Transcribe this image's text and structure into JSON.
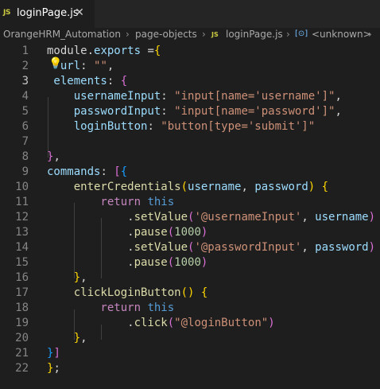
{
  "tab": {
    "lang_badge": "JS",
    "title": "loginPage.js",
    "close_glyph": "✕"
  },
  "breadcrumb": {
    "items": [
      "OrangeHRM_Automation",
      "page-objects",
      "loginPage.js",
      "<unknown>"
    ],
    "js_badge": "JS",
    "symbol_icon": "[⊙]"
  },
  "editor": {
    "active_line": 3,
    "line_numbers": [
      "1",
      "2",
      "3",
      "4",
      "5",
      "6",
      "7",
      "8",
      "9",
      "10",
      "11",
      "12",
      "13",
      "14",
      "15",
      "16",
      "17",
      "18",
      "19",
      "20",
      "21",
      "22"
    ],
    "lines": [
      [
        [
          "module",
          "k-pl"
        ],
        [
          ".",
          "k-pl"
        ],
        [
          "exports",
          "k-var"
        ],
        [
          " =",
          "k-pl"
        ],
        [
          "{",
          "k-b1"
        ]
      ],
      [
        [
          "  ",
          "k-pl"
        ],
        [
          "url",
          "k-var"
        ],
        [
          ": ",
          "k-pl"
        ],
        [
          "\"\"",
          "k-str"
        ],
        [
          ",",
          "k-pl"
        ]
      ],
      [
        [
          " elements",
          "k-var"
        ],
        [
          ": ",
          "k-pl"
        ],
        [
          "{",
          "k-b2"
        ]
      ],
      [
        [
          "    usernameInput",
          "k-var"
        ],
        [
          ": ",
          "k-pl"
        ],
        [
          "\"input[name='username']\"",
          "k-str"
        ],
        [
          ",",
          "k-pl"
        ]
      ],
      [
        [
          "    passwordInput",
          "k-var"
        ],
        [
          ": ",
          "k-pl"
        ],
        [
          "\"input[name='password']\"",
          "k-str"
        ],
        [
          ",",
          "k-pl"
        ]
      ],
      [
        [
          "    loginButton",
          "k-var"
        ],
        [
          ": ",
          "k-pl"
        ],
        [
          "\"button[type='submit']\"",
          "k-str"
        ]
      ],
      [
        [
          "",
          "k-pl"
        ]
      ],
      [
        [
          "}",
          "k-b2"
        ],
        [
          ",",
          "k-pl"
        ]
      ],
      [
        [
          "commands",
          "k-var"
        ],
        [
          ": ",
          "k-pl"
        ],
        [
          "[",
          "k-b2"
        ],
        [
          "{",
          "k-b3"
        ]
      ],
      [
        [
          "    enterCredentials",
          "k-fn"
        ],
        [
          "(",
          "k-b1"
        ],
        [
          "username",
          "k-var"
        ],
        [
          ", ",
          "k-pl"
        ],
        [
          "password",
          "k-var"
        ],
        [
          ")",
          "k-b1"
        ],
        [
          " ",
          "k-pl"
        ],
        [
          "{",
          "k-b1"
        ]
      ],
      [
        [
          "        return",
          "k-kw"
        ],
        [
          " ",
          "k-pl"
        ],
        [
          "this",
          "k-this"
        ]
      ],
      [
        [
          "            .",
          "k-pl"
        ],
        [
          "setValue",
          "k-fn"
        ],
        [
          "(",
          "k-b2"
        ],
        [
          "'@usernameInput'",
          "k-str"
        ],
        [
          ", ",
          "k-pl"
        ],
        [
          "username",
          "k-var"
        ],
        [
          ")",
          "k-b2"
        ]
      ],
      [
        [
          "            .",
          "k-pl"
        ],
        [
          "pause",
          "k-fn"
        ],
        [
          "(",
          "k-b2"
        ],
        [
          "1000",
          "k-num"
        ],
        [
          ")",
          "k-b2"
        ]
      ],
      [
        [
          "            .",
          "k-pl"
        ],
        [
          "setValue",
          "k-fn"
        ],
        [
          "(",
          "k-b2"
        ],
        [
          "'@passwordInput'",
          "k-str"
        ],
        [
          ", ",
          "k-pl"
        ],
        [
          "password",
          "k-var"
        ],
        [
          ")",
          "k-b2"
        ]
      ],
      [
        [
          "            .",
          "k-pl"
        ],
        [
          "pause",
          "k-fn"
        ],
        [
          "(",
          "k-b2"
        ],
        [
          "1000",
          "k-num"
        ],
        [
          ")",
          "k-b2"
        ]
      ],
      [
        [
          "    }",
          "k-b1"
        ],
        [
          ",",
          "k-pl"
        ]
      ],
      [
        [
          "    clickLoginButton",
          "k-fn"
        ],
        [
          "()",
          "k-b1"
        ],
        [
          " ",
          "k-pl"
        ],
        [
          "{",
          "k-b1"
        ]
      ],
      [
        [
          "        return",
          "k-kw"
        ],
        [
          " ",
          "k-pl"
        ],
        [
          "this",
          "k-this"
        ]
      ],
      [
        [
          "            .",
          "k-pl"
        ],
        [
          "click",
          "k-fn"
        ],
        [
          "(",
          "k-b2"
        ],
        [
          "\"@loginButton\"",
          "k-str"
        ],
        [
          ")",
          "k-b2"
        ]
      ],
      [
        [
          "    }",
          "k-b1"
        ],
        [
          ",",
          "k-pl"
        ]
      ],
      [
        [
          "}",
          "k-b3"
        ],
        [
          "]",
          "k-b2"
        ]
      ],
      [
        [
          "}",
          "k-b1"
        ],
        [
          ";",
          "k-pl"
        ]
      ]
    ]
  },
  "colors": {
    "background": "#1e1e1e",
    "tabbar": "#252526",
    "keyword": "#c586c0",
    "variable": "#9cdcfe",
    "string": "#ce9178",
    "function": "#dcdcaa",
    "number": "#b5cea8"
  },
  "icons": {
    "lightbulb": "lightbulb-icon",
    "close": "close-icon",
    "chevron": "chevron-right-icon",
    "symbol": "symbol-field-icon"
  }
}
